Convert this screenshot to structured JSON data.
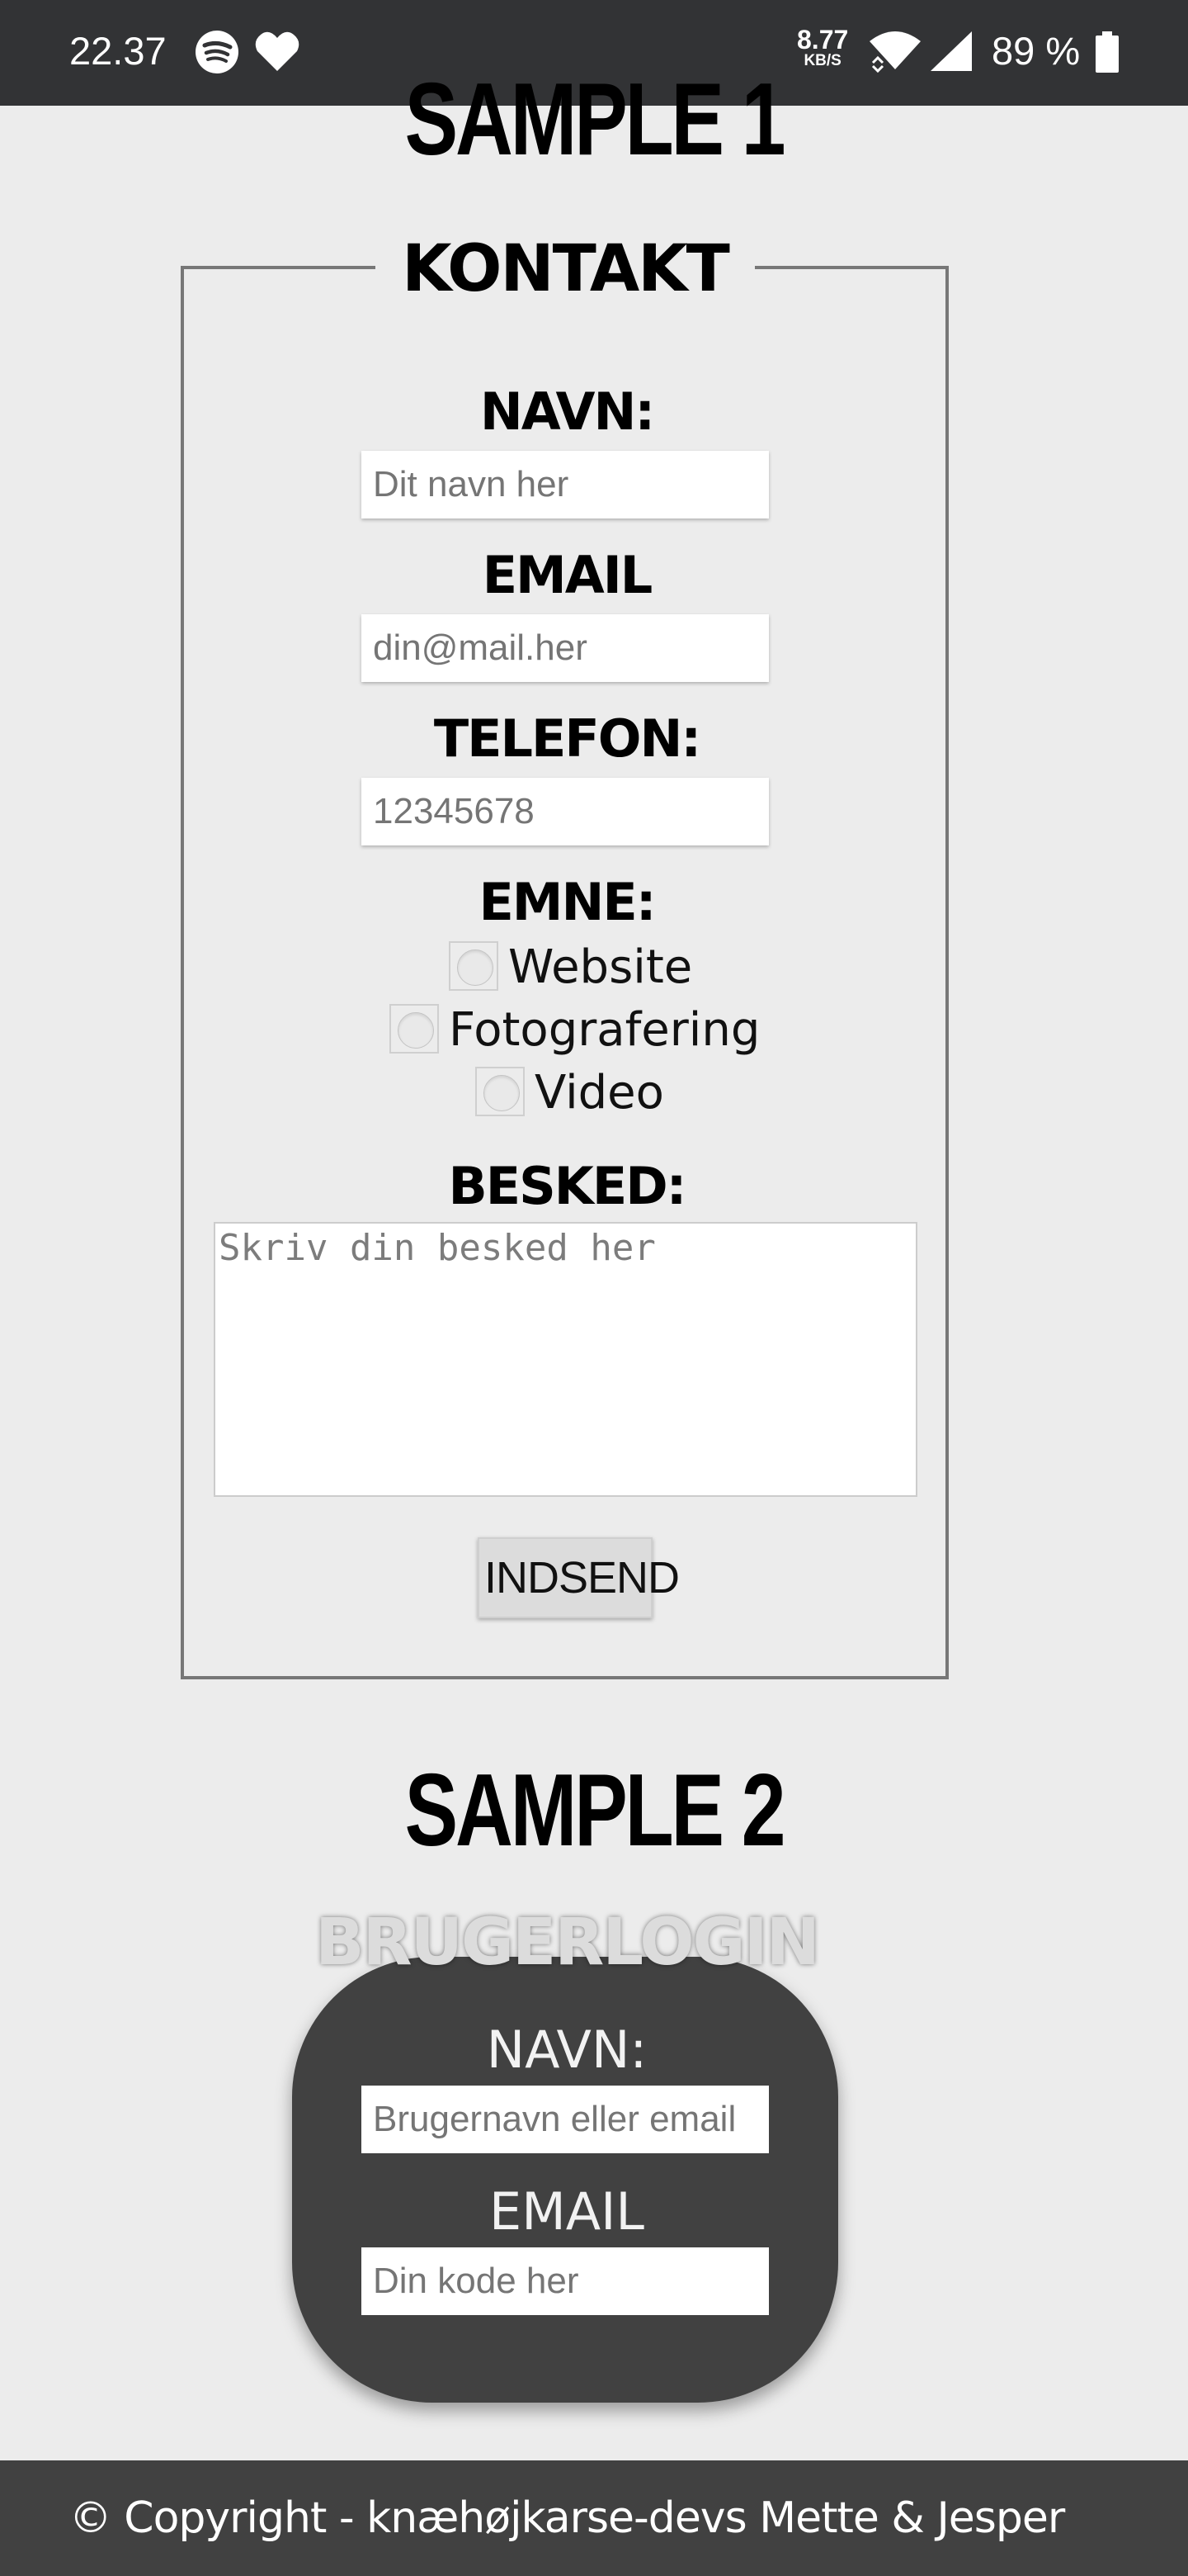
{
  "status_bar": {
    "time": "22.37",
    "app_icons": [
      "spotify-icon",
      "heart-icon"
    ],
    "network_speed_value": "8.77",
    "network_speed_unit": "KB/S",
    "battery_percent": "89 %"
  },
  "sample1": {
    "heading": "SAMPLE 1",
    "legend": "KONTAKT",
    "name_label": "NAVN:",
    "name_placeholder": "Dit navn her",
    "email_label": "EMAIL",
    "email_placeholder": "din@mail.her",
    "phone_label": "TELEFON:",
    "phone_placeholder": "12345678",
    "subject_label": "EMNE:",
    "subjects": [
      "Website",
      "Fotografering",
      "Video"
    ],
    "message_label": "BESKED:",
    "message_placeholder": "Skriv din besked her",
    "submit_label": "INDSEND"
  },
  "sample2": {
    "heading": "SAMPLE 2",
    "title": "BRUGERLOGIN",
    "name_label": "NAVN:",
    "name_placeholder": "Brugernavn eller email",
    "email_label": "EMAIL",
    "password_placeholder": "Din kode her"
  },
  "footer": {
    "text": "© Copyright - knæhøjkarse-devs Mette & Jesper"
  }
}
